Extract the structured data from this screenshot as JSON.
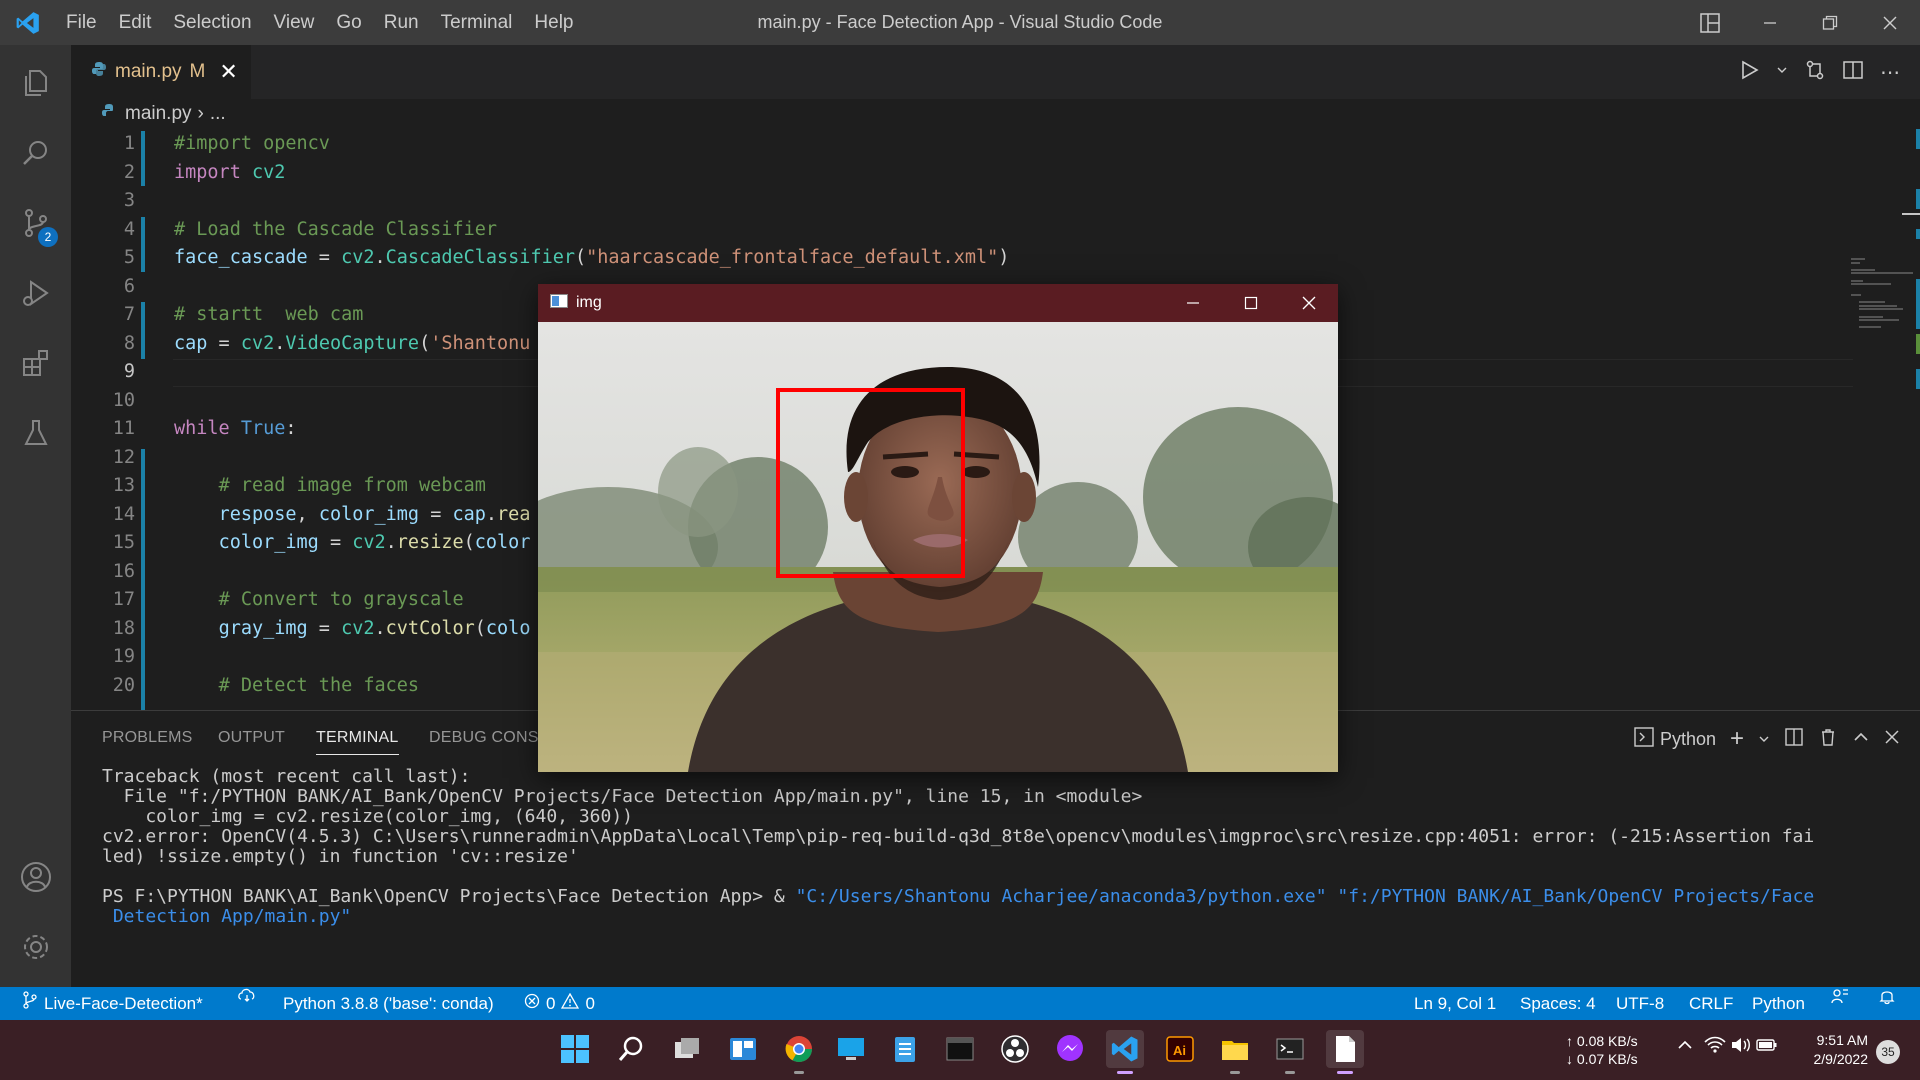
{
  "titlebar": {
    "menus": [
      "File",
      "Edit",
      "Selection",
      "View",
      "Go",
      "Run",
      "Terminal",
      "Help"
    ],
    "title": "main.py - Face Detection App - Visual Studio Code"
  },
  "activity": {
    "scm_badge": "2"
  },
  "tab": {
    "name": "main.py",
    "modified": "M"
  },
  "breadcrumb": {
    "file": "main.py",
    "rest": "..."
  },
  "editor": {
    "lines": [
      {
        "n": "1",
        "parts": [
          [
            "c-com",
            "#import opencv"
          ]
        ]
      },
      {
        "n": "2",
        "parts": [
          [
            "c-kw",
            "import"
          ],
          [
            "c-plain",
            " "
          ],
          [
            "c-mod",
            "cv2"
          ]
        ]
      },
      {
        "n": "3",
        "parts": []
      },
      {
        "n": "4",
        "parts": [
          [
            "c-com",
            "# Load the Cascade Classifier"
          ]
        ]
      },
      {
        "n": "5",
        "parts": [
          [
            "c-var",
            "face_cascade"
          ],
          [
            "c-plain",
            " = "
          ],
          [
            "c-mod",
            "cv2"
          ],
          [
            "c-plain",
            "."
          ],
          [
            "c-mod",
            "CascadeClassifier"
          ],
          [
            "c-plain",
            "("
          ],
          [
            "c-str",
            "\"haarcascade_frontalface_default.xml\""
          ],
          [
            "c-plain",
            ")"
          ]
        ]
      },
      {
        "n": "6",
        "parts": []
      },
      {
        "n": "7",
        "parts": [
          [
            "c-com",
            "# startt  web cam"
          ]
        ]
      },
      {
        "n": "8",
        "parts": [
          [
            "c-var",
            "cap"
          ],
          [
            "c-plain",
            " = "
          ],
          [
            "c-mod",
            "cv2"
          ],
          [
            "c-plain",
            "."
          ],
          [
            "c-mod",
            "VideoCapture"
          ],
          [
            "c-plain",
            "("
          ],
          [
            "c-str",
            "'Shantonu"
          ]
        ]
      },
      {
        "n": "9",
        "parts": []
      },
      {
        "n": "10",
        "parts": []
      },
      {
        "n": "11",
        "parts": [
          [
            "c-kw",
            "while"
          ],
          [
            "c-plain",
            " "
          ],
          [
            "c-bool",
            "True"
          ],
          [
            "c-plain",
            ":"
          ]
        ]
      },
      {
        "n": "12",
        "parts": []
      },
      {
        "n": "13",
        "parts": [
          [
            "c-plain",
            "    "
          ],
          [
            "c-com",
            "# read image from webcam"
          ]
        ]
      },
      {
        "n": "14",
        "parts": [
          [
            "c-plain",
            "    "
          ],
          [
            "c-var",
            "respose"
          ],
          [
            "c-plain",
            ", "
          ],
          [
            "c-var",
            "color_img"
          ],
          [
            "c-plain",
            " = "
          ],
          [
            "c-var",
            "cap"
          ],
          [
            "c-plain",
            "."
          ],
          [
            "c-fn",
            "rea"
          ]
        ]
      },
      {
        "n": "15",
        "parts": [
          [
            "c-plain",
            "    "
          ],
          [
            "c-var",
            "color_img"
          ],
          [
            "c-plain",
            " = "
          ],
          [
            "c-mod",
            "cv2"
          ],
          [
            "c-plain",
            "."
          ],
          [
            "c-fn",
            "resize"
          ],
          [
            "c-plain",
            "("
          ],
          [
            "c-var",
            "color"
          ]
        ]
      },
      {
        "n": "16",
        "parts": []
      },
      {
        "n": "17",
        "parts": [
          [
            "c-plain",
            "    "
          ],
          [
            "c-com",
            "# Convert to grayscale"
          ]
        ]
      },
      {
        "n": "18",
        "parts": [
          [
            "c-plain",
            "    "
          ],
          [
            "c-var",
            "gray_img"
          ],
          [
            "c-plain",
            " = "
          ],
          [
            "c-mod",
            "cv2"
          ],
          [
            "c-plain",
            "."
          ],
          [
            "c-fn",
            "cvtColor"
          ],
          [
            "c-plain",
            "("
          ],
          [
            "c-var",
            "colo"
          ]
        ]
      },
      {
        "n": "19",
        "parts": []
      },
      {
        "n": "20",
        "parts": [
          [
            "c-plain",
            "    "
          ],
          [
            "c-com",
            "# Detect the faces"
          ]
        ]
      }
    ]
  },
  "panel": {
    "tabs": [
      "PROBLEMS",
      "OUTPUT",
      "TERMINAL",
      "DEBUG CONSO"
    ],
    "shell": "Python",
    "terminal_lines": [
      "Traceback (most recent call last):",
      "  File \"f:/PYTHON BANK/AI_Bank/OpenCV Projects/Face Detection App/main.py\", line 15, in <module>",
      "    color_img = cv2.resize(color_img, (640, 360))",
      "cv2.error: OpenCV(4.5.3) C:\\Users\\runneradmin\\AppData\\Local\\Temp\\pip-req-build-q3d_8t8e\\opencv\\modules\\imgproc\\src\\resize.cpp:4051: error: (-215:Assertion fai",
      "led) !ssize.empty() in function 'cv::resize'",
      ""
    ],
    "prompt": "PS F:\\PYTHON BANK\\AI_Bank\\OpenCV Projects\\Face Detection App> & ",
    "cmd1": "\"C:/Users/Shantonu Acharjee/anaconda3/python.exe\"",
    "cmd2": " \"f:/PYTHON BANK/AI_Bank/OpenCV Projects/Face",
    "cmd3": " Detection App/main.py\""
  },
  "statusbar": {
    "branch": "Live-Face-Detection*",
    "interpreter": "Python 3.8.8 ('base': conda)",
    "errors": "0",
    "warnings": "0",
    "position": "Ln 9, Col 1",
    "spaces": "Spaces: 4",
    "encoding": "UTF-8",
    "eol": "CRLF",
    "language": "Python"
  },
  "imgwin": {
    "title": "img"
  },
  "tray": {
    "upload": "↑ 0.08 KB/s",
    "download": "↓ 0.07 KB/s",
    "time": "9:51 AM",
    "date": "2/9/2022",
    "notif": "35"
  },
  "colors": {
    "accent": "#007acc",
    "taskbar": "#3a1f25",
    "face_box": "#ff0000"
  }
}
